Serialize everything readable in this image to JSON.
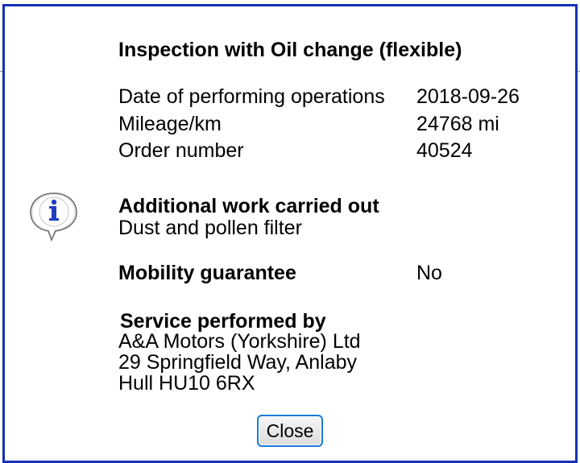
{
  "dialog": {
    "title": "Inspection with Oil change (flexible)",
    "details": [
      {
        "label": "Date of performing operations",
        "value": "2018-09-26"
      },
      {
        "label": "Mileage/km",
        "value": "24768 mi"
      },
      {
        "label": "Order number",
        "value": "40524"
      }
    ],
    "additional_work": {
      "heading": "Additional work carried out",
      "item": "Dust and pollen filter"
    },
    "mobility": {
      "label": "Mobility guarantee",
      "value": "No"
    },
    "service": {
      "heading": "Service performed by",
      "lines": [
        "A&A Motors (Yorkshire) Ltd",
        "29 Springfield Way, Anlaby",
        "Hull HU10 6RX"
      ]
    },
    "close_label": "Close",
    "icon": "info-speech-bubble-icon",
    "colors": {
      "border": "#1431b8",
      "button_border": "#1a7bd6",
      "icon_blue": "#1f3fbf"
    }
  }
}
